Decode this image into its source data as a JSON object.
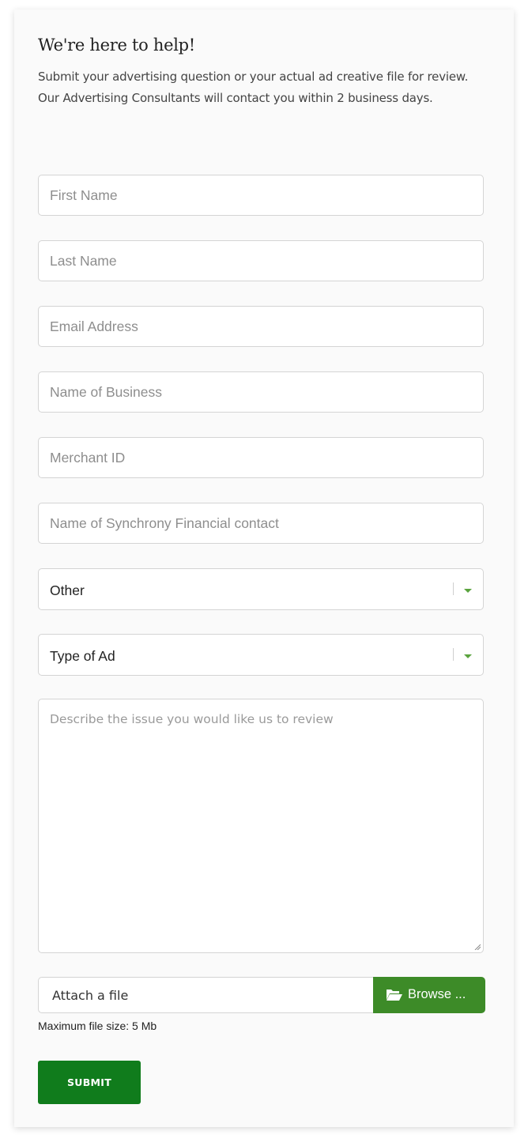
{
  "header": {
    "title": "We're here to help!",
    "intro": "Submit your advertising question or your actual ad creative file for review. Our Advertising Consultants will contact you within 2 business days."
  },
  "form": {
    "first_name": {
      "placeholder": "First Name",
      "value": ""
    },
    "last_name": {
      "placeholder": "Last Name",
      "value": ""
    },
    "email": {
      "placeholder": "Email Address",
      "value": ""
    },
    "business": {
      "placeholder": "Name of Business",
      "value": ""
    },
    "merchant_id": {
      "placeholder": "Merchant ID",
      "value": ""
    },
    "contact": {
      "placeholder": "Name of Synchrony Financial contact",
      "value": ""
    },
    "category_select": {
      "selected": "Other"
    },
    "ad_type_select": {
      "selected": "Type of Ad"
    },
    "description": {
      "placeholder": "Describe the issue you would like us to review",
      "value": ""
    },
    "file": {
      "placeholder": "Attach a file",
      "browse_label": "Browse ...",
      "browse_icon": "folder-open-icon",
      "max_size_note": "Maximum file size: 5 Mb"
    },
    "submit_label": "SUBMIT"
  },
  "colors": {
    "accent_green": "#3d8b28",
    "submit_green": "#107c1c",
    "arrow_green": "#5aa33e"
  }
}
